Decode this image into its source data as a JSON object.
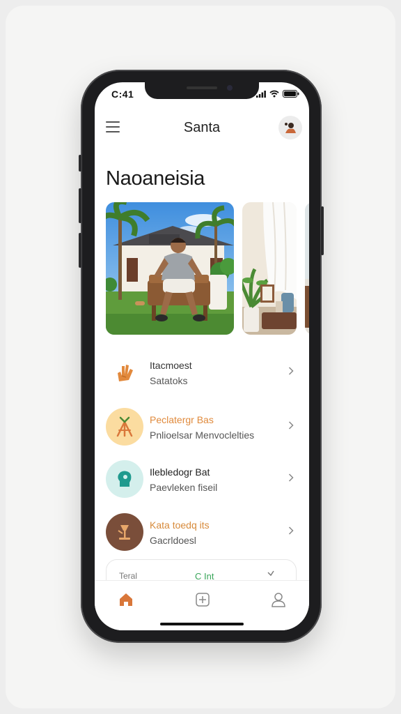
{
  "status_bar": {
    "time": "C:41"
  },
  "header": {
    "title": "Santa"
  },
  "page": {
    "title": "Naoaneisia"
  },
  "gallery": {
    "photos": [
      {
        "icon": "photo-man-seated-outdoors"
      },
      {
        "icon": "photo-interior-plant-curtain"
      },
      {
        "icon": "photo-partial"
      }
    ]
  },
  "list": {
    "items": [
      {
        "title": "Itacmoest",
        "subtitle": "Satatoks",
        "icon": "hand-icon",
        "title_color": "#333333",
        "icon_bg": "#ffffff"
      },
      {
        "title": "Peclatergr Bas",
        "subtitle": "Pnlioelsar Menvoclelties",
        "icon": "tripod-icon",
        "title_color": "#e08a3c",
        "icon_bg": "#fbdca0"
      },
      {
        "title": "Ilebledogr Bat",
        "subtitle": "Paevleken fiseil",
        "icon": "head-icon",
        "title_color": "#222222",
        "icon_bg": "#d4efec"
      },
      {
        "title": "Kata toedq its",
        "subtitle": "Gacrldoesl",
        "icon": "lamp-icon",
        "title_color": "#d78a3a",
        "icon_bg": "#7a4e3a"
      }
    ]
  },
  "filter": {
    "label": "Teral",
    "value": "C Int"
  },
  "tabbar": {
    "tabs": [
      {
        "icon": "home-icon",
        "active": true
      },
      {
        "icon": "plus-square-icon",
        "active": false
      },
      {
        "icon": "user-icon",
        "active": false
      }
    ]
  },
  "colors": {
    "accent": "#d9773a",
    "green": "#3aa65a"
  }
}
